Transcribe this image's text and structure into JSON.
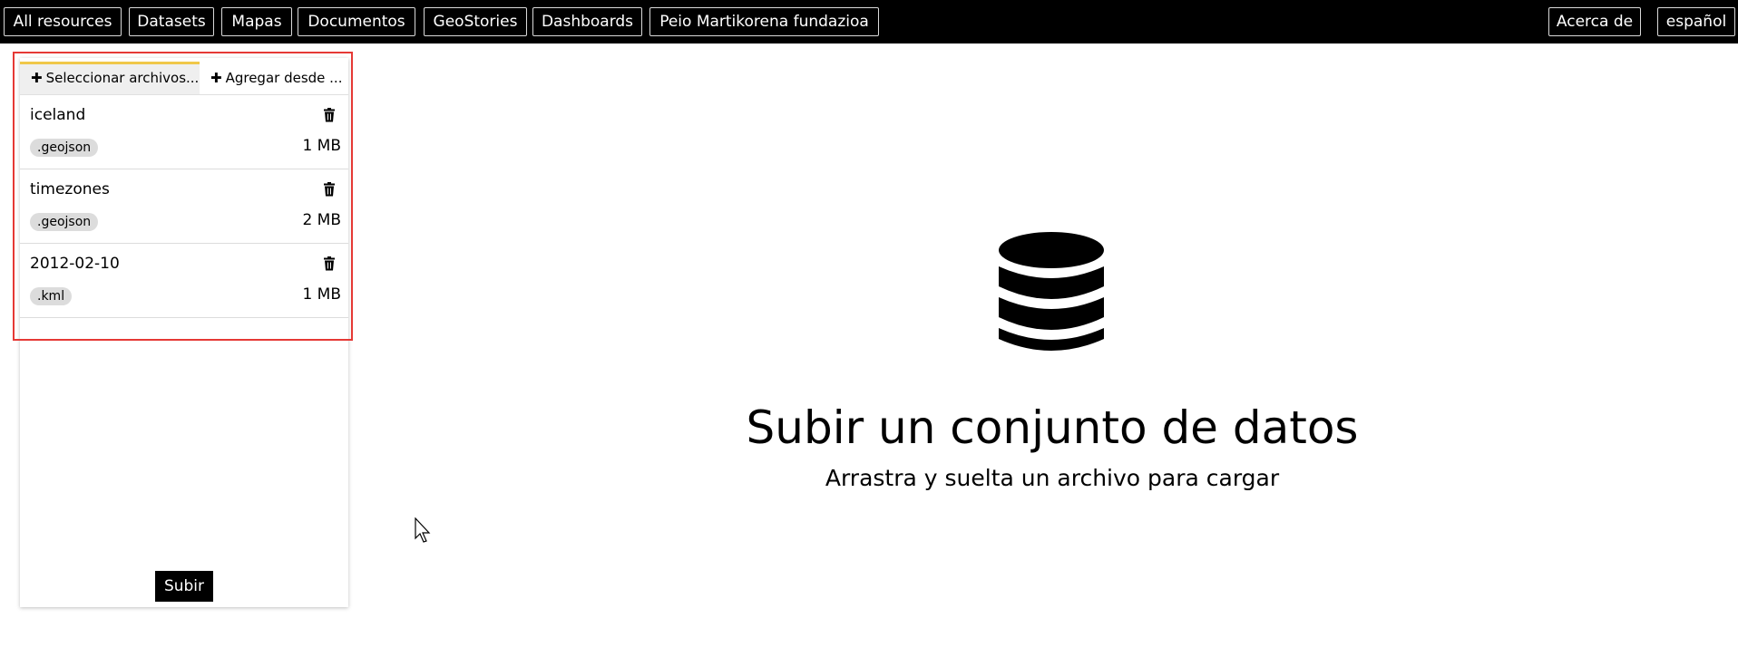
{
  "nav": {
    "items": [
      "All resources",
      "Datasets",
      "Mapas",
      "Documentos",
      "GeoStories",
      "Dashboards",
      "Peio Martikorena fundazioa"
    ],
    "right": [
      "Acerca de",
      "español"
    ]
  },
  "upload_panel": {
    "tabs": {
      "select_files": "Seleccionar archivos...",
      "add_from": "Agregar desde ..."
    },
    "files": [
      {
        "name": "iceland",
        "ext": ".geojson",
        "size": "1 MB"
      },
      {
        "name": "timezones",
        "ext": ".geojson",
        "size": "2 MB"
      },
      {
        "name": "2012-02-10",
        "ext": ".kml",
        "size": "1 MB"
      }
    ],
    "submit_label": "Subir"
  },
  "dropzone": {
    "icon": "database-icon",
    "title": "Subir un conjunto de datos",
    "subtitle": "Arrastra y suelta un archivo para cargar"
  },
  "colors": {
    "navbar_bg": "#000000",
    "tab_accent": "#f0c84a",
    "highlight": "#e53935"
  }
}
